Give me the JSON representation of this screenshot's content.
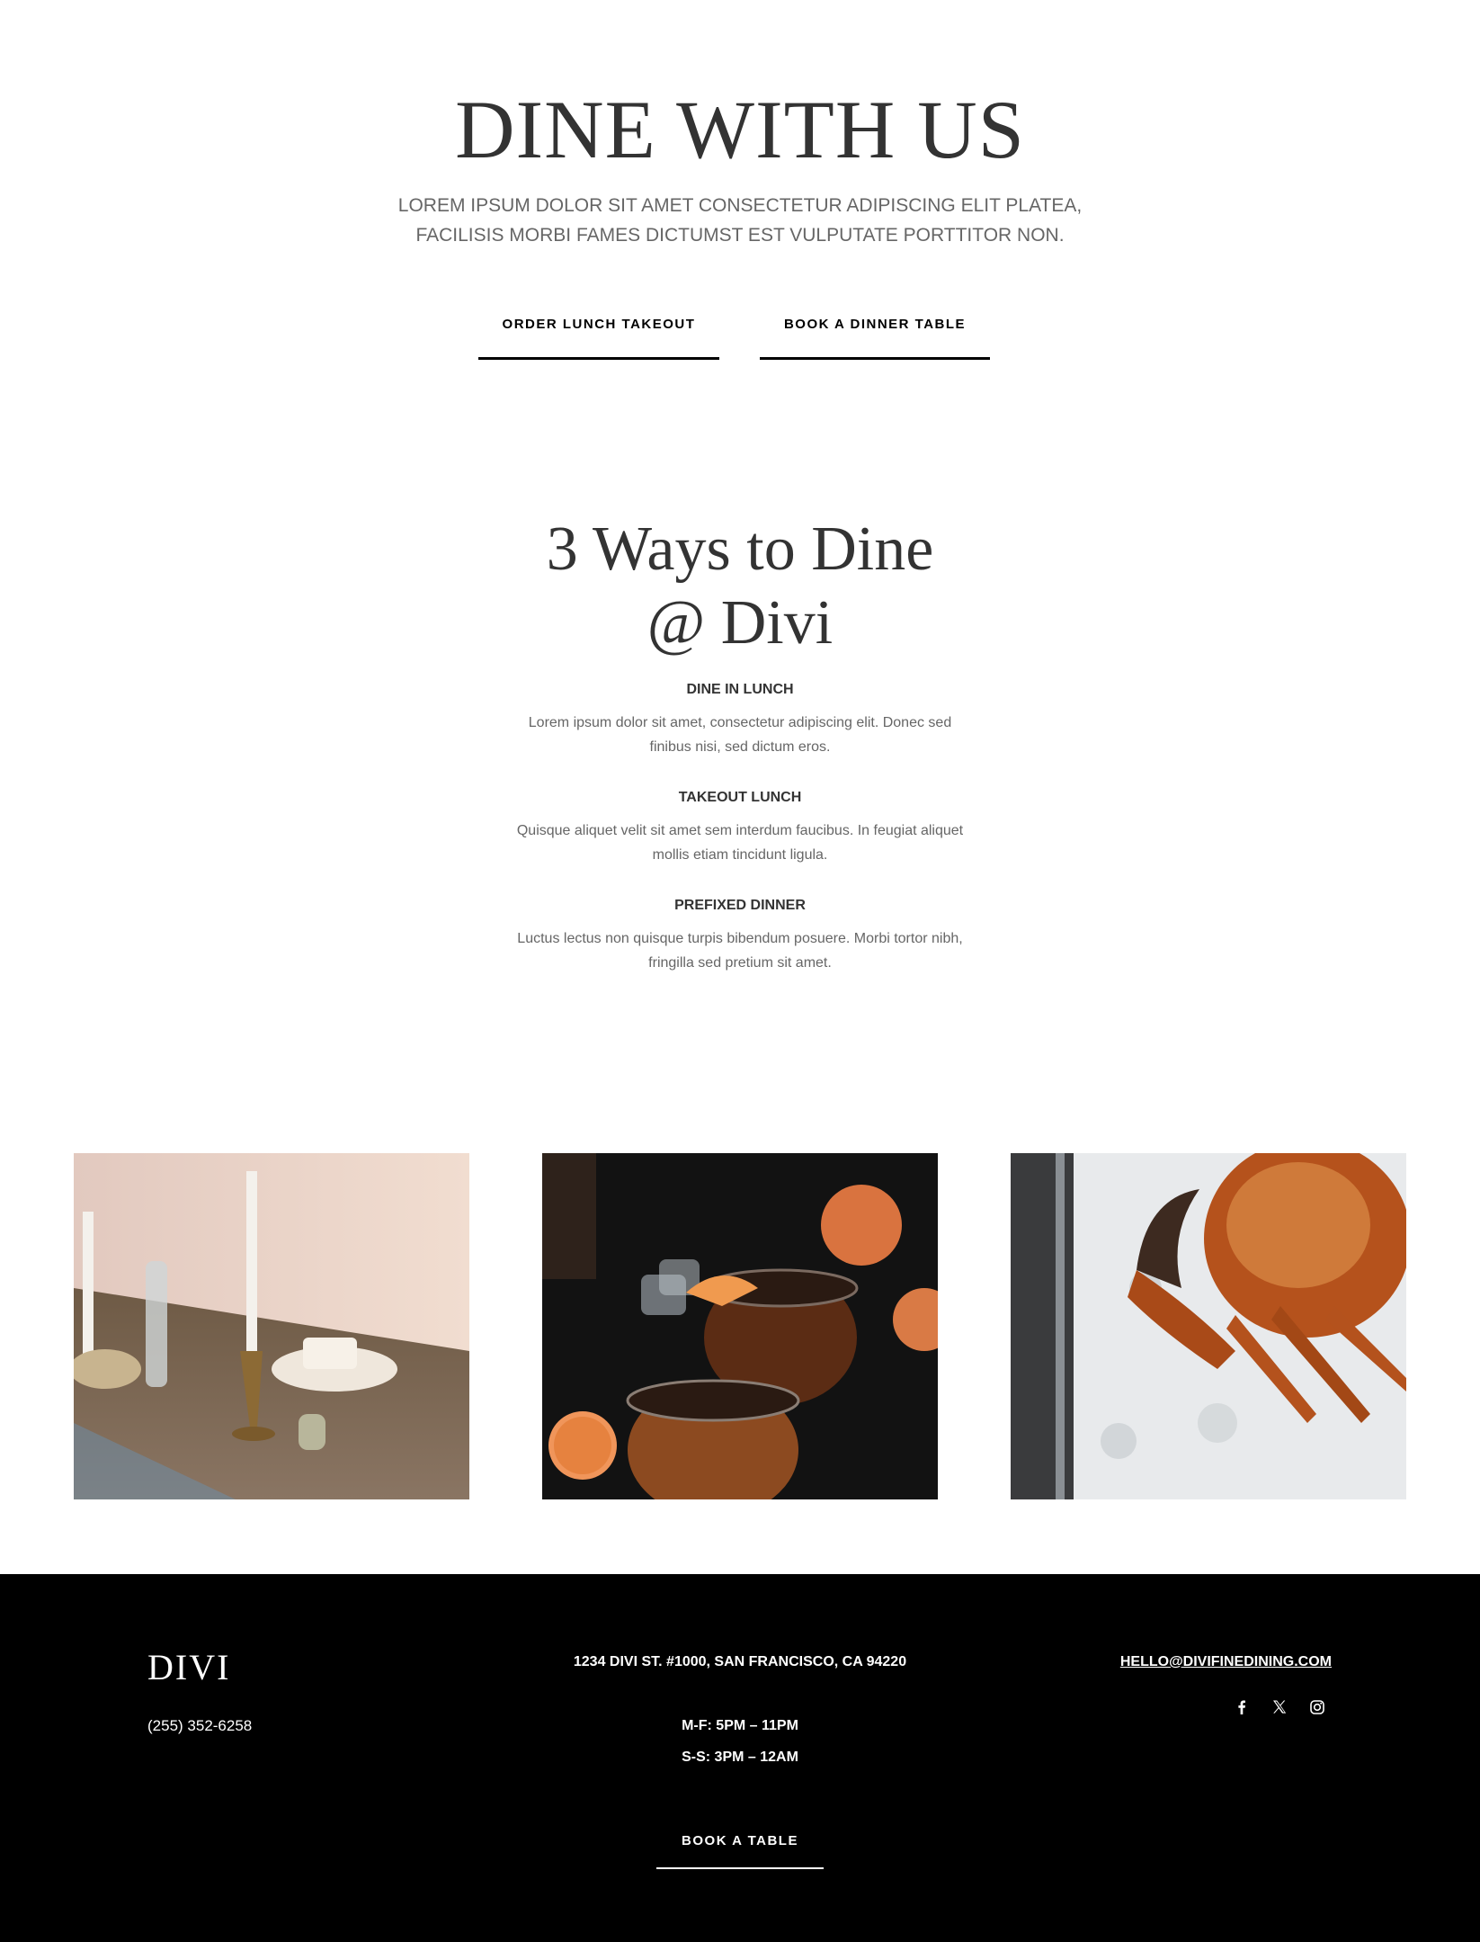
{
  "hero": {
    "title": "DINE WITH US",
    "subtitle_line1": "LOREM IPSUM DOLOR SIT AMET CONSECTETUR ADIPISCING ELIT PLATEA,",
    "subtitle_line2": "FACILISIS MORBI FAMES DICTUMST EST VULPUTATE PORTTITOR NON.",
    "buttons": {
      "order_lunch": "ORDER LUNCH TAKEOUT",
      "book_dinner": "BOOK A DINNER TABLE"
    }
  },
  "ways": {
    "title_line1": "3 Ways to Dine",
    "title_line2": "@ Divi",
    "items": [
      {
        "title": "DINE IN LUNCH",
        "line1": "Lorem ipsum dolor sit amet, consectetur adipiscing elit. Donec sed",
        "line2": "finibus nisi, sed dictum eros."
      },
      {
        "title": "TAKEOUT LUNCH",
        "line1": "Quisque aliquet velit sit amet sem interdum faucibus. In feugiat aliquet",
        "line2": "mollis etiam tincidunt ligula."
      },
      {
        "title": "PREFIXED DINNER",
        "line1": "Luctus lectus non quisque turpis bibendum posuere. Morbi tortor nibh,",
        "line2": "fringilla sed pretium sit amet."
      }
    ]
  },
  "gallery": {
    "images": [
      "table-candles-photo",
      "citrus-cocktails-photo",
      "crab-on-ice-photo"
    ]
  },
  "footer": {
    "logo": "DIVI",
    "phone": "(255) 352-6258",
    "address": "1234 DIVI ST. #1000, SAN FRANCISCO, CA 94220",
    "hours_weekday": "M-F: 5PM – 11PM",
    "hours_weekend": "S-S: 3PM – 12AM",
    "email": "HELLO@DIVIFINEDINING.COM",
    "social_icons": [
      "facebook-icon",
      "x-icon",
      "instagram-icon"
    ],
    "book_button": "BOOK A TABLE"
  },
  "colors": {
    "heading": "#333333",
    "body_text": "#666666",
    "footer_bg": "#000000",
    "footer_text": "#ffffff"
  }
}
